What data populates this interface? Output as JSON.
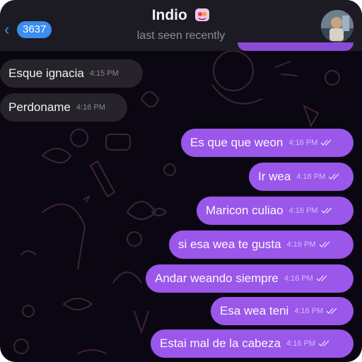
{
  "header": {
    "back_count": "3637",
    "contact_name": "Indio",
    "status": "last seen recently"
  },
  "colors": {
    "incoming_bubble": "#26232b",
    "outgoing_bubble": "#9a57ea",
    "accent": "#3b8df0",
    "background": "#0b0712"
  },
  "messages": [
    {
      "direction": "incoming",
      "text": "Esque ignacia",
      "time": "4:15 PM"
    },
    {
      "direction": "incoming",
      "text": "Perdoname",
      "time": "4:16 PM"
    },
    {
      "direction": "outgoing",
      "text": "Es que que weon",
      "time": "4:16 PM",
      "status": "read-double-check-icon"
    },
    {
      "direction": "outgoing",
      "text": "Ir wea",
      "time": "4:16 PM",
      "status": "read-double-check-icon"
    },
    {
      "direction": "outgoing",
      "text": "Maricon culiao",
      "time": "4:16 PM",
      "status": "read-double-check-icon"
    },
    {
      "direction": "outgoing",
      "text": "si esa wea te gusta",
      "time": "4:16 PM",
      "status": "read-double-check-icon"
    },
    {
      "direction": "outgoing",
      "text": "Andar weando siempre",
      "time": "4:16 PM",
      "status": "read-double-check-icon"
    },
    {
      "direction": "outgoing",
      "text": "Esa wea teni",
      "time": "4:16 PM",
      "status": "read-double-check-icon"
    },
    {
      "direction": "outgoing",
      "text": "Estai mal de la cabeza",
      "time": "4:16 PM",
      "status": "read-double-check-icon"
    }
  ]
}
